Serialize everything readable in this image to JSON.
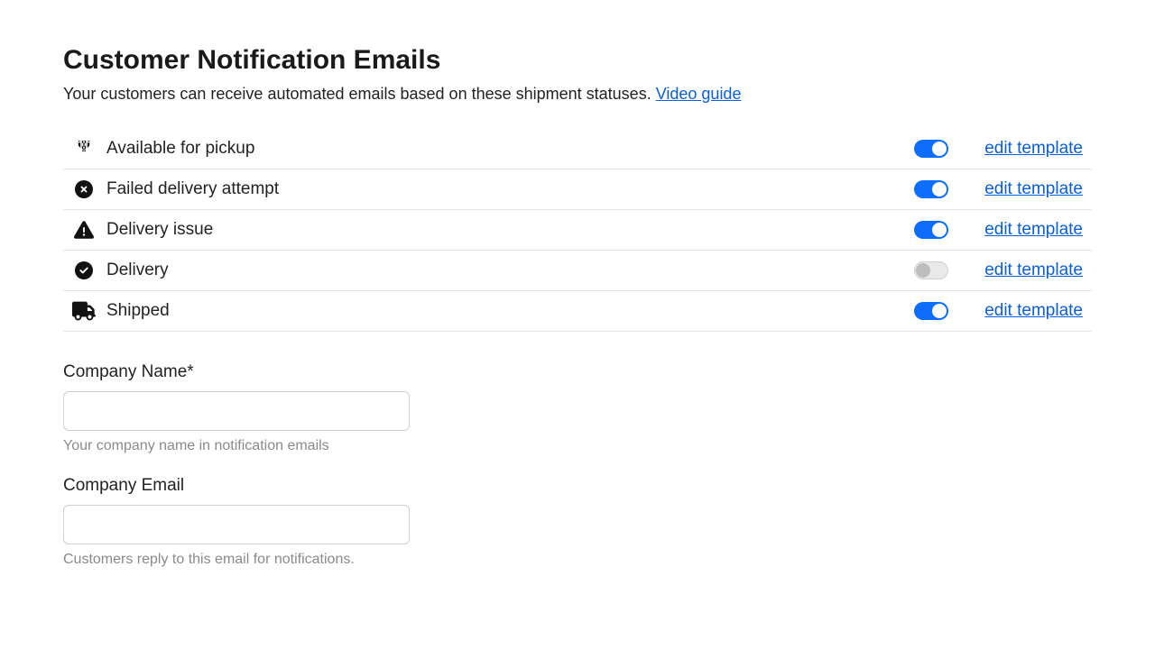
{
  "header": {
    "title": "Customer Notification Emails",
    "subtitle_text": "Your customers can receive automated emails based on these shipment statuses. ",
    "video_guide_text": "Video guide"
  },
  "rows": [
    {
      "icon": "hands-icon",
      "label": "Available for pickup",
      "enabled": true,
      "edit_text": "edit template"
    },
    {
      "icon": "circle-x-icon",
      "label": "Failed delivery attempt",
      "enabled": true,
      "edit_text": "edit template"
    },
    {
      "icon": "triangle-exclamation-icon",
      "label": "Delivery issue",
      "enabled": true,
      "edit_text": "edit template"
    },
    {
      "icon": "circle-check-icon",
      "label": "Delivery",
      "enabled": false,
      "edit_text": "edit template"
    },
    {
      "icon": "truck-icon",
      "label": "Shipped",
      "enabled": true,
      "edit_text": "edit template"
    }
  ],
  "form": {
    "company_name": {
      "label": "Company Name*",
      "value": "",
      "help": "Your company name in notification emails"
    },
    "company_email": {
      "label": "Company Email",
      "value": "",
      "help": "Customers reply to this email for notifications."
    }
  }
}
